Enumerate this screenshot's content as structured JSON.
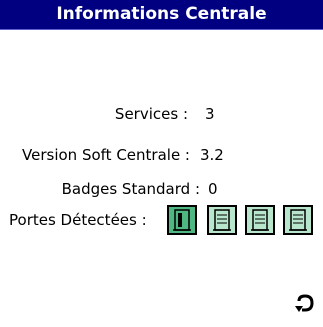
{
  "window": {
    "title": "Informations Centrale"
  },
  "info": {
    "services_label": "Services :",
    "services_value": "3",
    "version_label": "Version Soft Centrale :",
    "version_value": "3.2",
    "badges_label": "Badges Standard :",
    "badges_value": "0",
    "doors_label": "Portes Détectées :"
  },
  "doors": {
    "items": [
      {
        "icon": "door-open-icon",
        "state": "active"
      },
      {
        "icon": "door-closed-icon",
        "state": "inactive"
      },
      {
        "icon": "door-closed-icon",
        "state": "inactive"
      },
      {
        "icon": "door-closed-icon",
        "state": "inactive"
      }
    ],
    "colors": {
      "active": "#4fb882",
      "inactive": "#b8e6cc"
    }
  },
  "colors": {
    "titlebar": "#000080",
    "title_text": "#ffffff"
  },
  "actions": {
    "undo_icon": "undo-icon"
  }
}
